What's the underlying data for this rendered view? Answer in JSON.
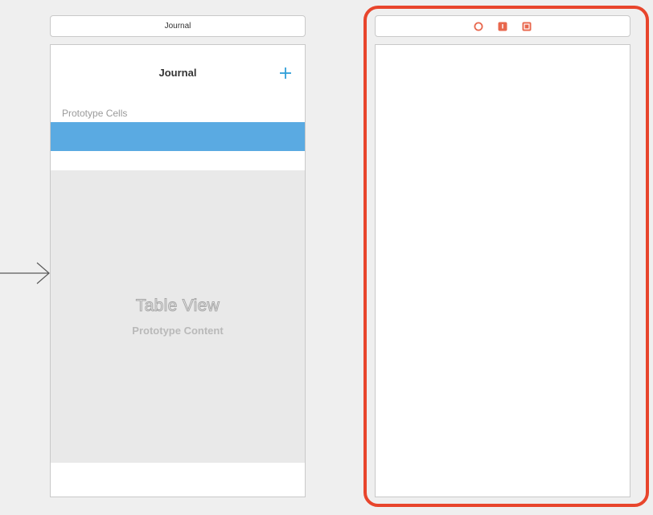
{
  "left_scene": {
    "scene_title": "Journal",
    "nav_title": "Journal",
    "add_button_icon": "plus-icon",
    "section_header": "Prototype Cells",
    "table_view_title": "Table View",
    "table_view_subtitle": "Prototype Content"
  },
  "right_scene": {
    "dock_icons": [
      "view-controller-icon",
      "first-responder-icon",
      "exit-icon"
    ],
    "selected": true
  },
  "colors": {
    "canvas_background": "#efefef",
    "selected_cell": "#5aaae2",
    "add_button": "#2f9fd8",
    "selection_outline": "#e8452c",
    "dock_icon": "#e8674d"
  }
}
